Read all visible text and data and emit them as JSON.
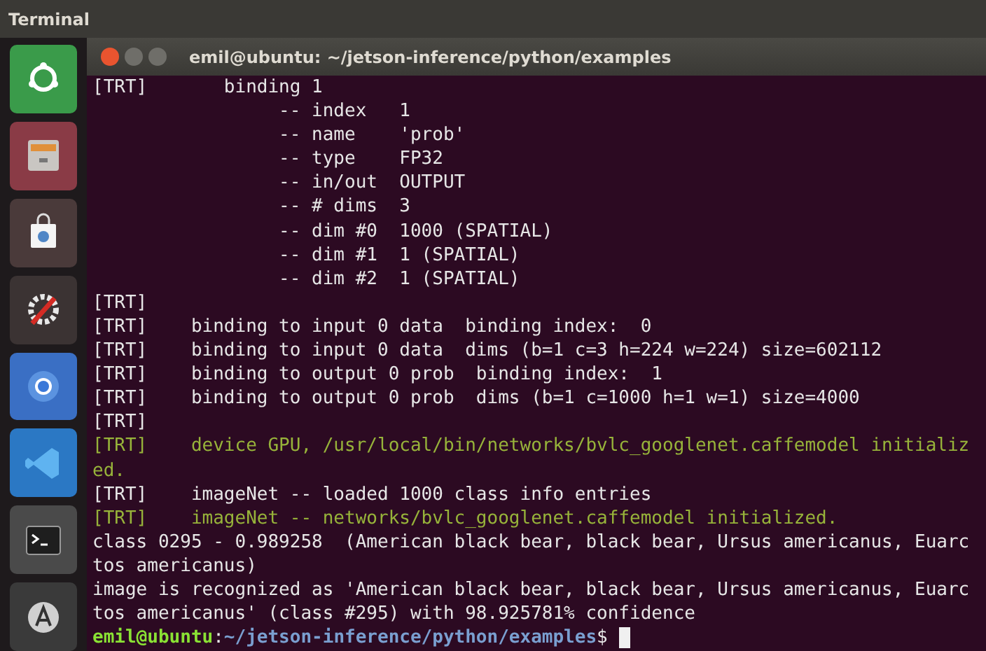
{
  "top_bar": {
    "title": "Terminal"
  },
  "window": {
    "title": "emil@ubuntu: ~/jetson-inference/python/examples"
  },
  "lines": [
    {
      "text": "[TRT]       binding 1",
      "kind": "log"
    },
    {
      "text": "                 -- index   1",
      "kind": "log"
    },
    {
      "text": "                 -- name    'prob'",
      "kind": "log"
    },
    {
      "text": "                 -- type    FP32",
      "kind": "log"
    },
    {
      "text": "                 -- in/out  OUTPUT",
      "kind": "log"
    },
    {
      "text": "                 -- # dims  3",
      "kind": "log"
    },
    {
      "text": "                 -- dim #0  1000 (SPATIAL)",
      "kind": "log"
    },
    {
      "text": "                 -- dim #1  1 (SPATIAL)",
      "kind": "log"
    },
    {
      "text": "                 -- dim #2  1 (SPATIAL)",
      "kind": "log"
    },
    {
      "text": "[TRT]",
      "kind": "log"
    },
    {
      "text": "[TRT]    binding to input 0 data  binding index:  0",
      "kind": "log"
    },
    {
      "text": "[TRT]    binding to input 0 data  dims (b=1 c=3 h=224 w=224) size=602112",
      "kind": "log"
    },
    {
      "text": "[TRT]    binding to output 0 prob  binding index:  1",
      "kind": "log"
    },
    {
      "text": "[TRT]    binding to output 0 prob  dims (b=1 c=1000 h=1 w=1) size=4000",
      "kind": "log"
    },
    {
      "text": "[TRT]",
      "kind": "log"
    },
    {
      "text": "[TRT]    device GPU, /usr/local/bin/networks/bvlc_googlenet.caffemodel initializ",
      "kind": "notice"
    },
    {
      "text": "ed.",
      "kind": "notice"
    },
    {
      "text": "[TRT]    imageNet -- loaded 1000 class info entries",
      "kind": "log"
    },
    {
      "text": "[TRT]    imageNet -- networks/bvlc_googlenet.caffemodel initialized.",
      "kind": "notice"
    },
    {
      "text": "class 0295 - 0.989258  (American black bear, black bear, Ursus americanus, Euarc",
      "kind": "log"
    },
    {
      "text": "tos americanus)",
      "kind": "log"
    },
    {
      "text": "image is recognized as 'American black bear, black bear, Ursus americanus, Euarc",
      "kind": "log"
    },
    {
      "text": "tos americanus' (class #295) with 98.925781% confidence",
      "kind": "log"
    }
  ],
  "prompt": {
    "user": "emil@ubuntu",
    "separator": ":",
    "path": "~/jetson-inference/python/examples",
    "symbol": "$"
  }
}
